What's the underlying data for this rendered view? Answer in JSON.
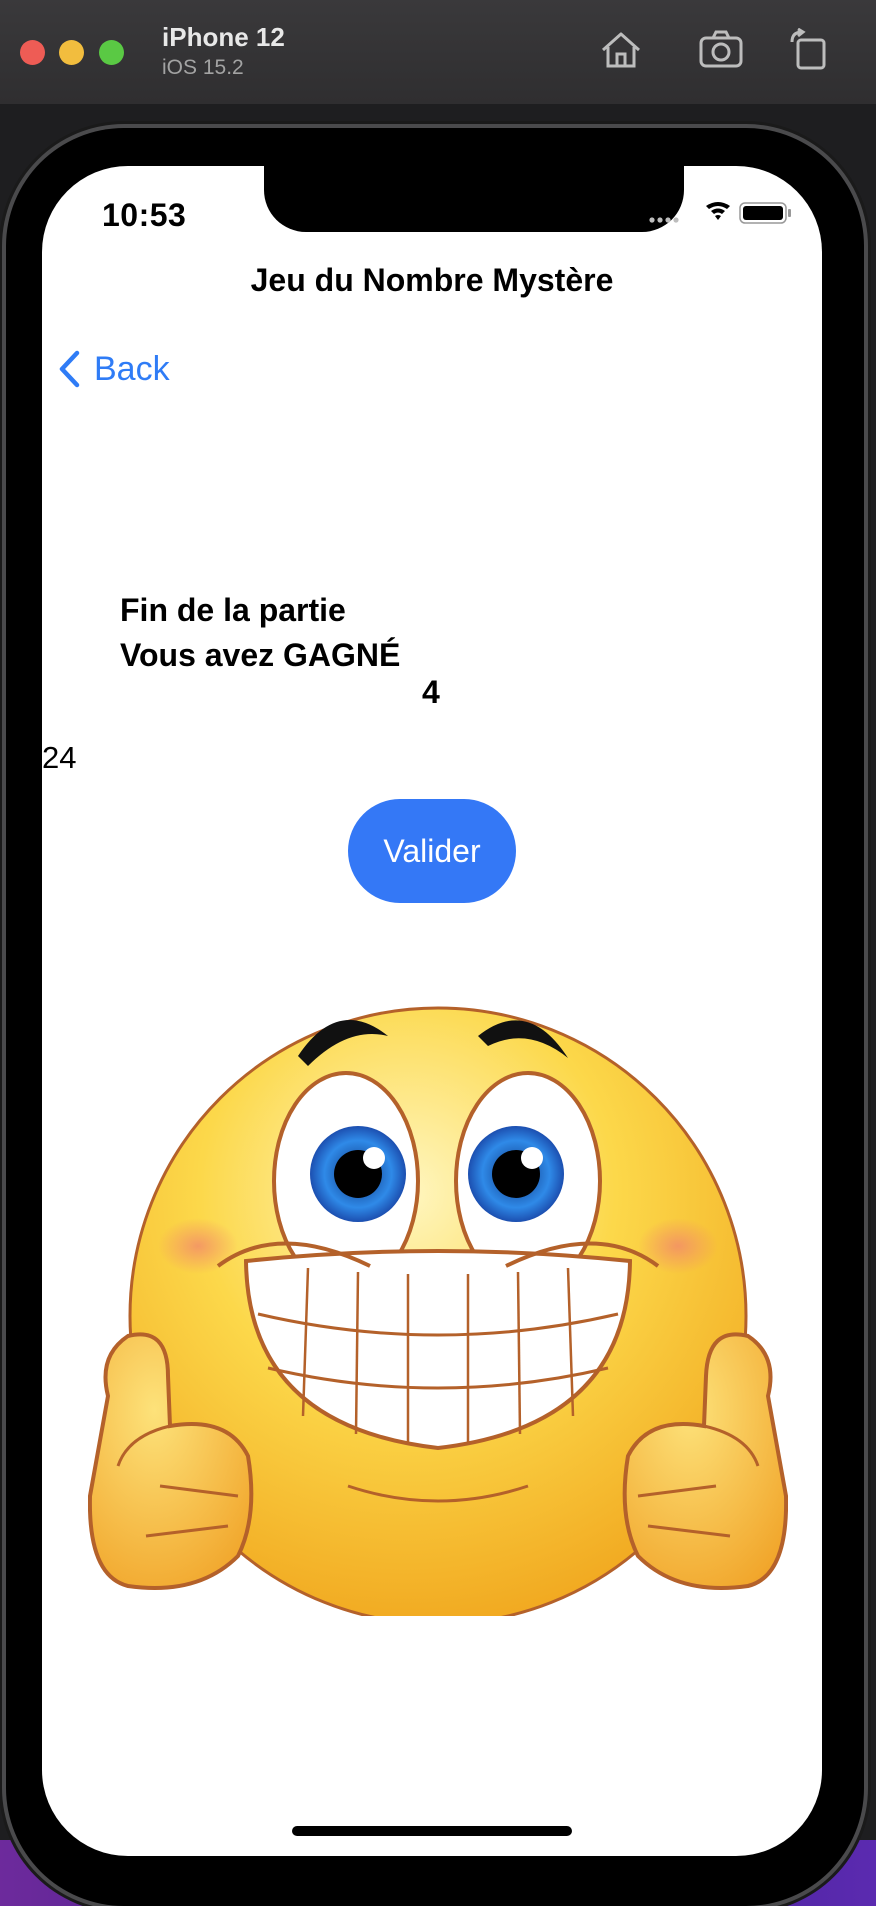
{
  "simulator": {
    "device_name": "iPhone 12",
    "os_version": "iOS 15.2",
    "toolbar_icons": [
      "home-icon",
      "screenshot-icon",
      "rotate-icon"
    ]
  },
  "status_bar": {
    "time": "10:53",
    "icons": [
      "signal-icon",
      "wifi-icon",
      "battery-icon"
    ]
  },
  "nav": {
    "title": "Jeu du Nombre Mystère",
    "back_label": "Back"
  },
  "game": {
    "result_line1": "Fin de la partie",
    "result_line2": "Vous avez GAGNÉ",
    "mystery_number": "4",
    "entered_value": "24",
    "validate_label": "Valider"
  },
  "image": {
    "description": "thumbs-up smiley emoji"
  },
  "colors": {
    "accent": "#3478f6",
    "background": "#ffffff"
  }
}
